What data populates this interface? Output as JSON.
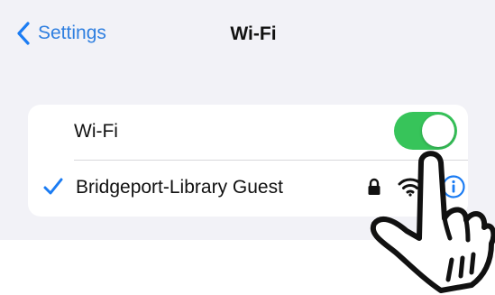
{
  "nav": {
    "back_label": "Settings",
    "title": "Wi-Fi"
  },
  "wifi_row": {
    "label": "Wi-Fi",
    "toggle_on": true
  },
  "network": {
    "name": "Bridgeport-Library Guest",
    "connected": true,
    "secured": true
  },
  "colors": {
    "accent": "#1b7cf3",
    "toggle_on": "#37c45a",
    "background": "#f2f2f7"
  },
  "icons": [
    "chevron-left-icon",
    "checkmark-icon",
    "lock-icon",
    "wifi-icon",
    "info-icon",
    "pointing-hand-icon"
  ]
}
